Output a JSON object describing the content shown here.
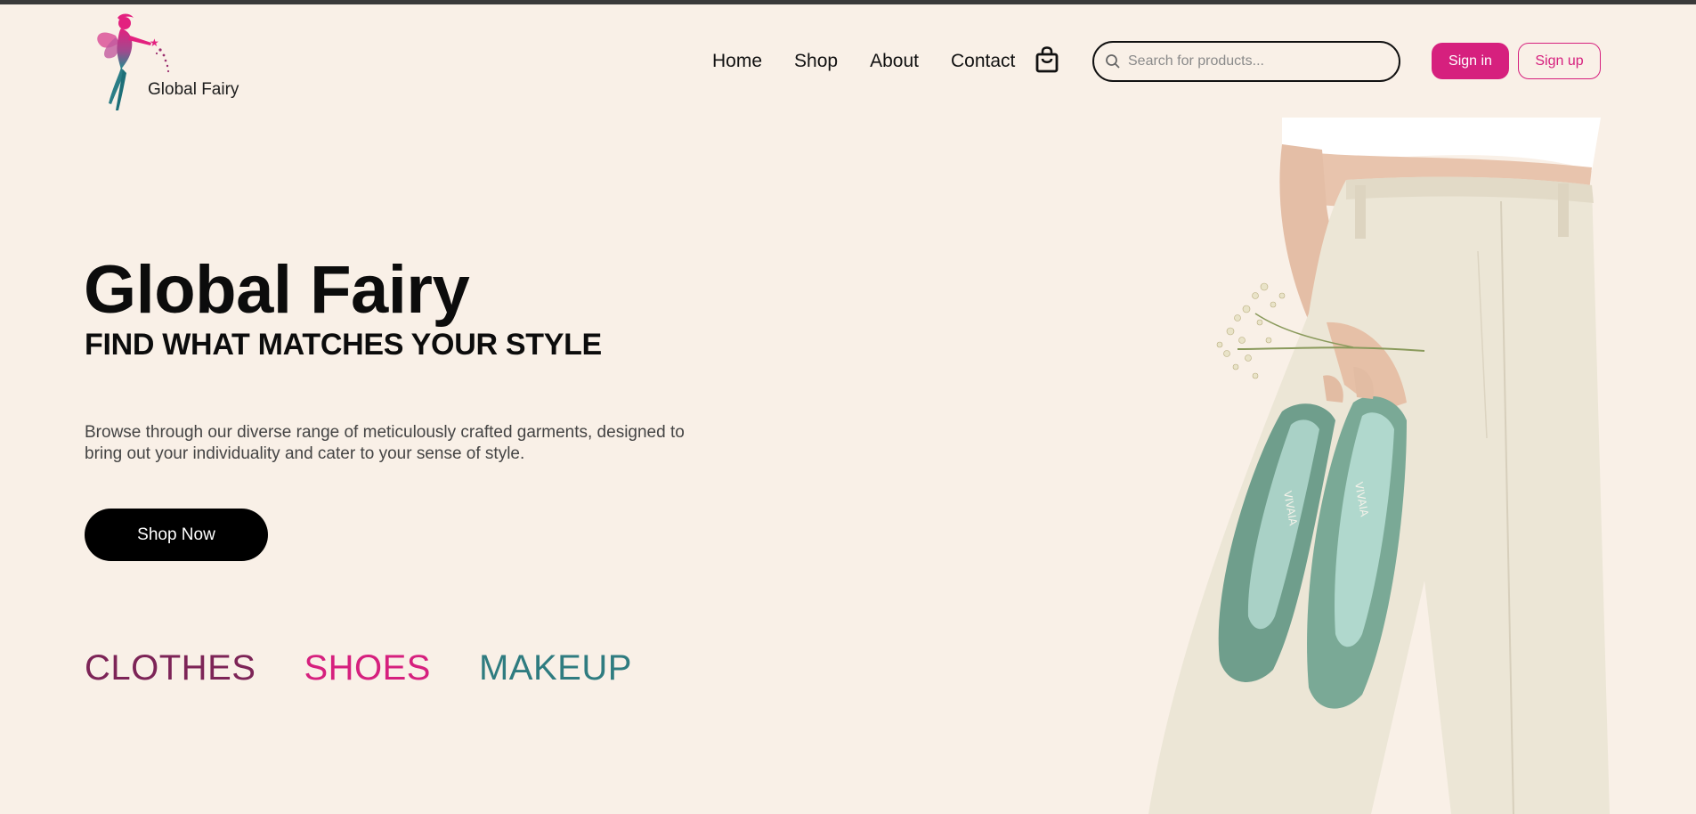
{
  "brand": {
    "name": "Global Fairy",
    "logo_icon": "fairy-icon",
    "colors": {
      "accent": "#d6207e",
      "plum": "#7d2457",
      "teal": "#2f7c80",
      "background": "#f9f0e7"
    }
  },
  "nav": {
    "items": [
      {
        "label": "Home"
      },
      {
        "label": "Shop"
      },
      {
        "label": "About"
      },
      {
        "label": "Contact"
      }
    ],
    "cart_icon": "shopping-bag-icon"
  },
  "search": {
    "placeholder": "Search for products...",
    "value": "",
    "icon": "search-icon"
  },
  "auth": {
    "signin_label": "Sign in",
    "signup_label": "Sign up"
  },
  "hero": {
    "title": "Global Fairy",
    "subtitle": "FIND WHAT MATCHES YOUR STYLE",
    "description": "Browse through our diverse range of meticulously crafted garments, designed to bring out your individuality and cater to your sense of style.",
    "cta_label": "Shop Now",
    "image": "woman-holding-green-flats-image",
    "categories": [
      {
        "label": "CLOTHES",
        "color": "#7d2457"
      },
      {
        "label": "SHOES",
        "color": "#d6207e"
      },
      {
        "label": "MAKEUP",
        "color": "#2f7c80"
      }
    ],
    "shoe_brand": "VIVAIA"
  }
}
